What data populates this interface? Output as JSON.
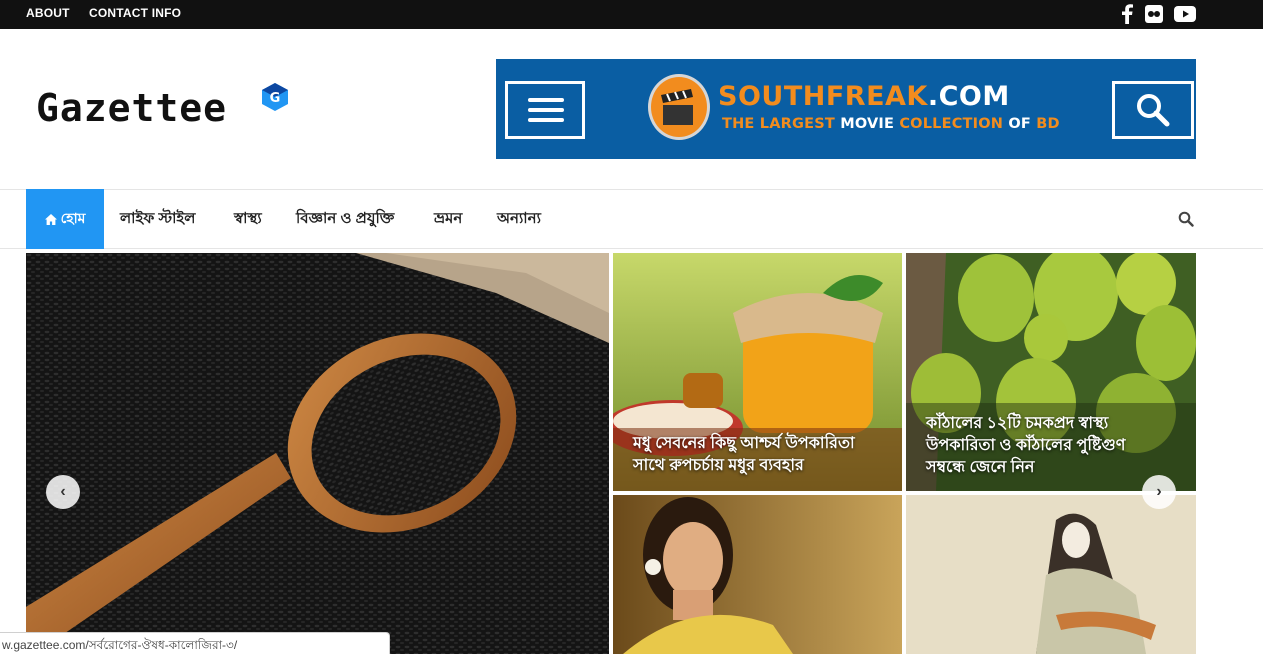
{
  "topbar": {
    "links": [
      "ABOUT",
      "CONTACT INFO"
    ],
    "social_icons": [
      "facebook-icon",
      "flickr-icon",
      "youtube-icon"
    ]
  },
  "header": {
    "logo_text": "Gazettee",
    "logo_badge": "G"
  },
  "banner": {
    "title_part1": "SOUTH",
    "title_part2": "FREAK",
    "title_part3": ".COM",
    "subtitle_part1": "THE LARGEST ",
    "subtitle_part2": "MOVIE",
    "subtitle_part3": " COLLECTION ",
    "subtitle_part4": "OF",
    "subtitle_part5": " BD",
    "colors": {
      "background": "#0a5ea3",
      "orange": "#f28c1e",
      "white": "#ffffff"
    }
  },
  "nav": {
    "home_icon": "home-icon",
    "home_label": "হোম",
    "items": [
      "লাইফ স্টাইল",
      "স্বাস্থ্য",
      "বিজ্ঞান ও প্রযুক্তি",
      "ভ্রমন",
      "অন্যান্য"
    ],
    "search_icon": "search-icon",
    "accent_color": "#2196f3"
  },
  "slider": {
    "prev_label": "‹",
    "next_label": "›"
  },
  "posts": [
    {
      "title_line1": "মধু সেবনের কিছু আশ্চর্য উপকারিতা",
      "title_line2": "সাথে রুপচর্চায় মধুর ব্যবহার"
    },
    {
      "title_line1": "কাঁঠালের ১২টি চমকপ্রদ স্বাস্থ্য",
      "title_line2": "উপকারিতা ও কাঁঠালের পুষ্টিগুণ",
      "title_line3": "সম্বন্ধে জেনে নিন"
    }
  ],
  "status_bar": {
    "url": "w.gazettee.com/সর্বরোগের-ঔষধ-কালোজিরা-৩/"
  }
}
